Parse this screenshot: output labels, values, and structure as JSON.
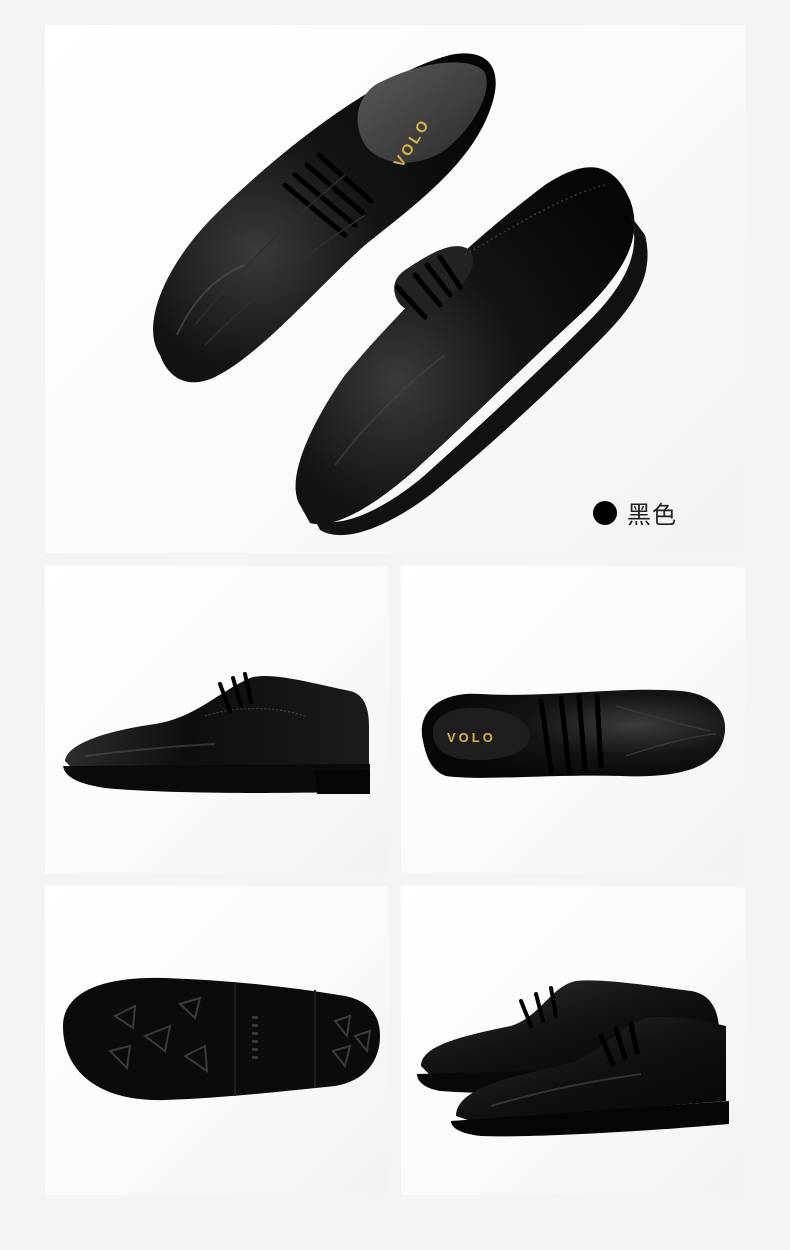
{
  "product": {
    "brand": "VOLO",
    "colors": {
      "shoe": "#0d0d0d",
      "insole_logo": "#d9b24a",
      "background": "#ffffff"
    }
  },
  "color_option": {
    "label": "黑色",
    "swatch_color": "#000000"
  },
  "views": [
    {
      "name": "top-pair"
    },
    {
      "name": "side"
    },
    {
      "name": "top"
    },
    {
      "name": "sole"
    },
    {
      "name": "pair-angle"
    }
  ]
}
